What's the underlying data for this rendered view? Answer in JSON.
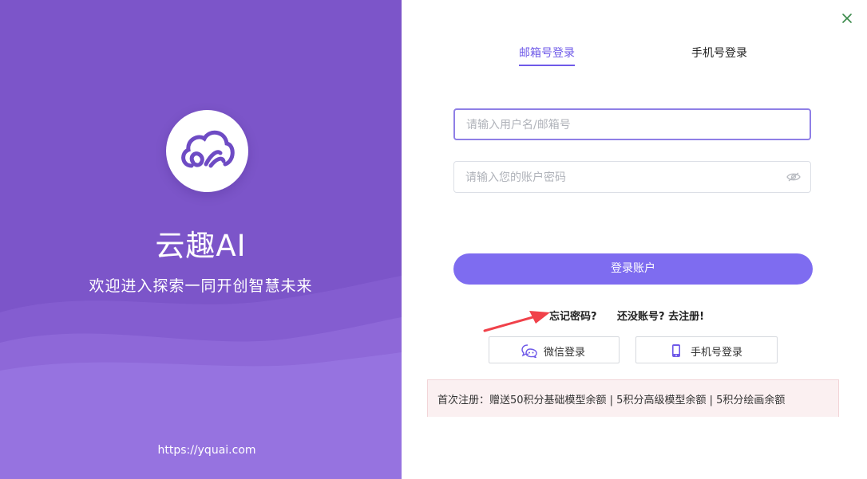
{
  "brand": {
    "app_name": "云趣AI",
    "tagline": "欢迎进入探索一同开创智慧未来",
    "site_url": "https://yquai.com",
    "logo_icon": "cloud-logo-icon",
    "panel_color": "#7c55c9"
  },
  "login": {
    "tabs": [
      {
        "label": "邮箱号登录",
        "active": true
      },
      {
        "label": "手机号登录",
        "active": false
      }
    ],
    "username_placeholder": "请输入用户名/邮箱号",
    "password_placeholder": "请输入您的账户密码",
    "submit_label": "登录账户",
    "forgot_password": "忘记密码?",
    "register_link": "还没账号? 去注册!",
    "wechat_login_label": "微信登录",
    "phone_login_label": "手机号登录",
    "notice": "首次注册：赠送50积分基础模型余额 | 5积分高级模型余额 | 5积分绘画余额",
    "accent_color": "#6f5ae8",
    "button_color": "#7e6cf0"
  },
  "icons": [
    "close-icon",
    "eye-icon",
    "wechat-icon",
    "phone-icon",
    "arrow-annotation"
  ]
}
